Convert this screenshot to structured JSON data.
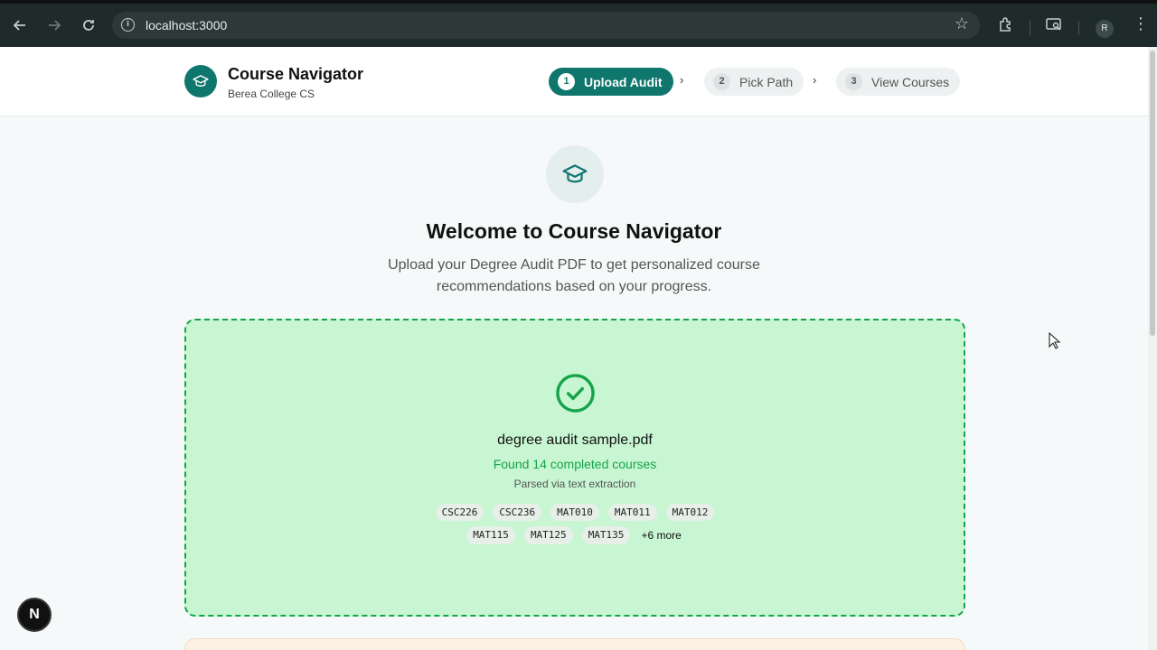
{
  "browser": {
    "url": "localhost:3000",
    "profile_initial": "R",
    "icons": [
      "back-icon",
      "forward-icon",
      "reload-icon",
      "site-info-icon",
      "bookmark-star-icon",
      "extensions-icon",
      "tab-search-icon",
      "menu-icon"
    ]
  },
  "header": {
    "title": "Course Navigator",
    "subtitle": "Berea College CS",
    "steps": [
      {
        "num": "1",
        "label": "Upload Audit"
      },
      {
        "num": "2",
        "label": "Pick Path"
      },
      {
        "num": "3",
        "label": "View Courses"
      }
    ]
  },
  "main": {
    "welcome": "Welcome to Course Navigator",
    "description": "Upload your Degree Audit PDF to get personalized course recommendations based on your progress.",
    "upload": {
      "filename": "degree audit sample.pdf",
      "found": "Found 14 completed courses",
      "parsed": "Parsed via text extraction",
      "courses_row1": [
        "CSC226",
        "CSC236",
        "MAT010",
        "MAT011",
        "MAT012"
      ],
      "courses_row2": [
        "MAT115",
        "MAT125",
        "MAT135"
      ],
      "more": "+6 more"
    }
  },
  "dev_badge": "N",
  "colors": {
    "accent": "#0f766e",
    "success": "#16a34a",
    "dropzone_bg": "#c8f6d2"
  }
}
